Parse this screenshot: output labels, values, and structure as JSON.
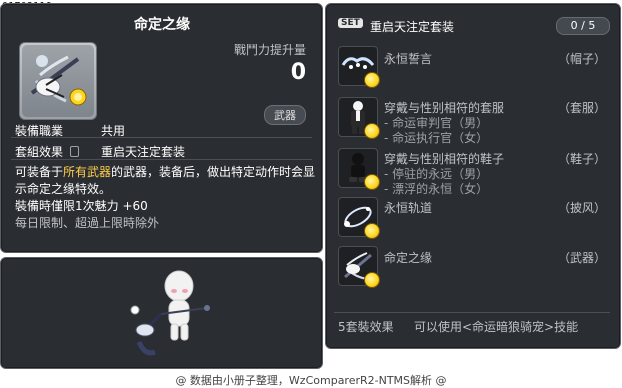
{
  "item_id": "01703116",
  "item": {
    "title": "命定之缘",
    "power_label": "戰鬥力提升量",
    "power_value": "0",
    "category_tag": "武器",
    "job_label": "裝備職業",
    "job_value": "共用",
    "set_label": "套組效果",
    "set_value": "重启天注定套装",
    "desc_line1_pre": "可装备于",
    "desc_line1_highlight": "所有武器",
    "desc_line1_post": "的武器，装备后，做出特定动作时会显",
    "desc_line2": "示命定之缘特效。",
    "charm_line": "裝備時僅限1次魅力  +60",
    "limit_line": "每日限制、超過上限時除外"
  },
  "set_panel": {
    "badge": "SET",
    "title": "重启天注定套装",
    "count": "0 / 5",
    "items": [
      {
        "name": "永恒誓言",
        "sub": [],
        "category": "（帽子）",
        "icon": "halo-wings-icon"
      },
      {
        "name": "穿戴与性别相符的套服",
        "sub": [
          "- 命运审判官（男）",
          "- 命运执行官（女）"
        ],
        "category": "（套服）",
        "icon": "suit-icon"
      },
      {
        "name": "穿戴与性别相符的鞋子",
        "sub": [
          "- 停驻的永远（男）",
          "- 漂浮的永恒（女）"
        ],
        "category": "（鞋子）",
        "icon": "shoes-icon"
      },
      {
        "name": "永恒轨道",
        "sub": [],
        "category": "（披风）",
        "icon": "orbit-cape-icon"
      },
      {
        "name": "命定之缘",
        "sub": [],
        "category": "（武器）",
        "icon": "crossbow-icon"
      }
    ],
    "set_effect_label": "5套裝效果",
    "set_effect_value": "可以使用<命运暗狼骑宠>技能"
  },
  "footer": "@ 数据由小册子整理，WzComparerR2-NTMS解析 @"
}
